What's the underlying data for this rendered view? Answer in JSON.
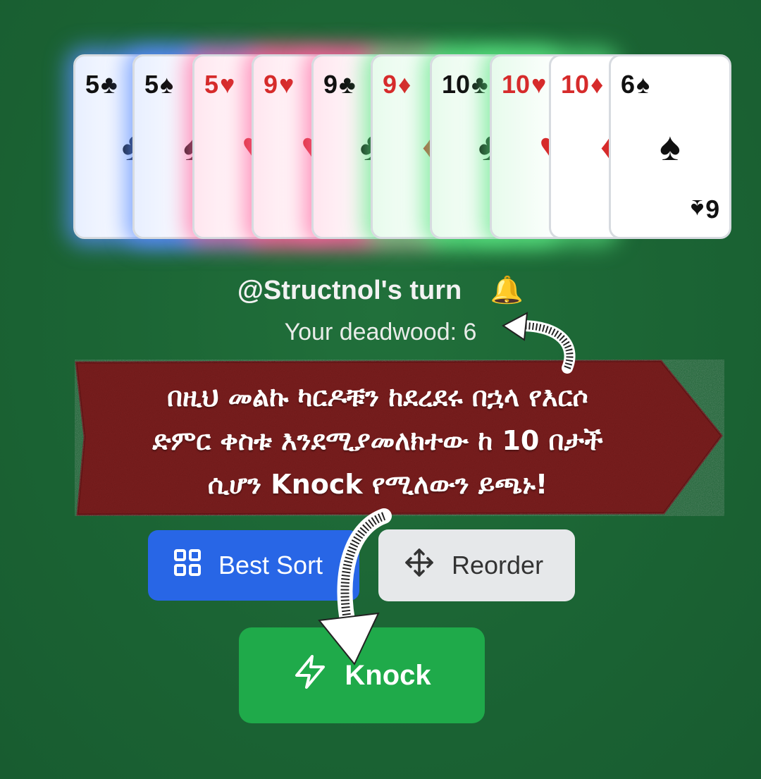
{
  "hand": {
    "cards": [
      {
        "rank": "5",
        "suit": "♣",
        "color": "black",
        "glow": "blue"
      },
      {
        "rank": "5",
        "suit": "♠",
        "color": "black",
        "glow": "blue"
      },
      {
        "rank": "5",
        "suit": "♥",
        "color": "red",
        "glow": "pink"
      },
      {
        "rank": "9",
        "suit": "♥",
        "color": "red",
        "glow": "pink"
      },
      {
        "rank": "9",
        "suit": "♣",
        "color": "black",
        "glow": "pink"
      },
      {
        "rank": "9",
        "suit": "♦",
        "color": "red",
        "glow": "green"
      },
      {
        "rank": "10",
        "suit": "♣",
        "color": "black",
        "glow": "green"
      },
      {
        "rank": "10",
        "suit": "♥",
        "color": "red",
        "glow": "green"
      },
      {
        "rank": "10",
        "suit": "♦",
        "color": "red",
        "glow": "none"
      },
      {
        "rank": "6",
        "suit": "♠",
        "color": "black",
        "glow": "none"
      }
    ]
  },
  "turn": {
    "text": "@Structnol's turn",
    "icon": "bell-icon"
  },
  "deadwood": {
    "text": "Your deadwood: 6"
  },
  "banner": {
    "lines": [
      "በዚህ መልኩ ካርዶቹን ከደረደሩ በኋላ የእርሶ",
      "ድምር ቀስቱ እንደሚያመለክተው ከ 10 በታች",
      "ሲሆን Knock የሚለውን ይጫኑ!"
    ],
    "color": "#7a1e1e"
  },
  "buttons": {
    "sort": {
      "label": "Best Sort",
      "icon": "grid-icon",
      "color": "#2866e6"
    },
    "reorder": {
      "label": "Reorder",
      "icon": "move-icon",
      "color": "#e6e8ea"
    },
    "knock": {
      "label": "Knock",
      "icon": "lightning-icon",
      "color": "#1faa4a"
    }
  },
  "colors": {
    "table": "#1b6434",
    "red_suit": "#d62b2b"
  }
}
